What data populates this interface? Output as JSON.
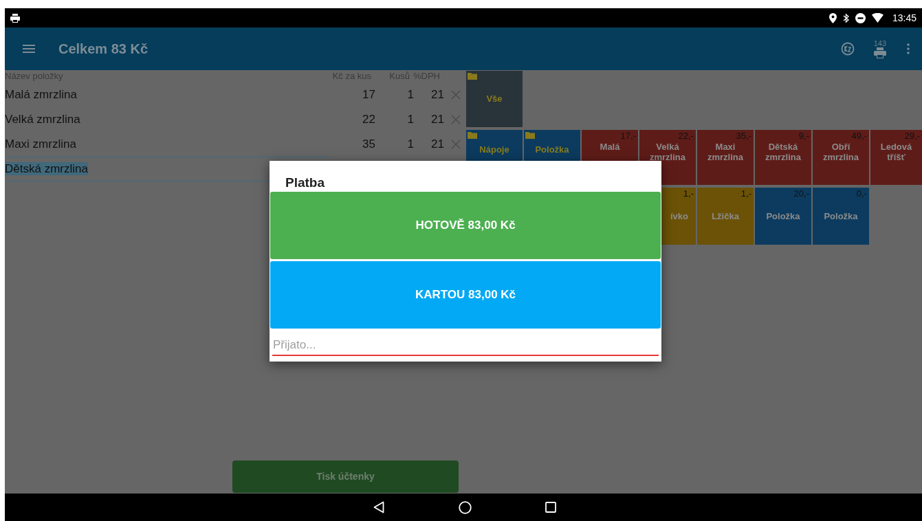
{
  "status_bar": {
    "time": "13:45"
  },
  "app_bar": {
    "title": "Celkem 83 Kč",
    "print_count": "143"
  },
  "order": {
    "columns": [
      "Název položky",
      "Kč za kus",
      "Kusů",
      "%DPH"
    ],
    "rows": [
      {
        "name": "Malá zmrzlina",
        "price": "17",
        "qty": "1",
        "vat": "21",
        "selected": false
      },
      {
        "name": "Velká zmrzlina",
        "price": "22",
        "qty": "1",
        "vat": "21",
        "selected": false
      },
      {
        "name": "Maxi zmrzlina",
        "price": "35",
        "qty": "1",
        "vat": "21",
        "selected": false
      },
      {
        "name": "Dětská zmrzlina",
        "selected": true
      }
    ],
    "print_button": "Tisk účtenky"
  },
  "tiles": [
    [
      {
        "kind": "folder",
        "label": "Vše",
        "color": "#29333a"
      }
    ],
    [
      {
        "kind": "folder",
        "label": "Nápoje",
        "color": "#0c3b5f"
      },
      {
        "kind": "folder",
        "label": "Položka",
        "color": "#0c3b5f"
      },
      {
        "kind": "item",
        "label": "Malá",
        "price": "17,-",
        "color": "#5e1c18"
      },
      {
        "kind": "item",
        "label": "Velká zmrzlina",
        "price": "22,-",
        "color": "#5e1c18"
      },
      {
        "kind": "item",
        "label": "Maxi zmrzlina",
        "price": "35,-",
        "color": "#5e1c18"
      },
      {
        "kind": "item",
        "label": "Dětská zmrzlina",
        "price": "9,-",
        "color": "#5e1c18"
      },
      {
        "kind": "item",
        "label": "Obří zmrzlina",
        "price": "49,-",
        "color": "#5e1c18"
      },
      {
        "kind": "item",
        "label": "Ledová tříšť",
        "price": "29,-",
        "color": "#5e1c18"
      }
    ],
    [
      {
        "kind": "item",
        "label": "ívko",
        "price": "1,-",
        "color": "#6b5207"
      },
      {
        "kind": "item",
        "label": "Lžička",
        "price": "1,-",
        "color": "#6b5207"
      },
      {
        "kind": "item",
        "label": "Položka",
        "price": "20,-",
        "color": "#0c3b5f"
      },
      {
        "kind": "item",
        "label": "Položka",
        "price": "0,-",
        "color": "#0c3b5f"
      }
    ]
  ],
  "dialog": {
    "title": "Platba",
    "buttons": [
      {
        "kind": "cash",
        "label": "HOTOVĚ 83,00 Kč"
      },
      {
        "kind": "card",
        "label": "KARTOU 83,00 Kč"
      }
    ],
    "field": {
      "placeholder": "Přijato..."
    }
  }
}
